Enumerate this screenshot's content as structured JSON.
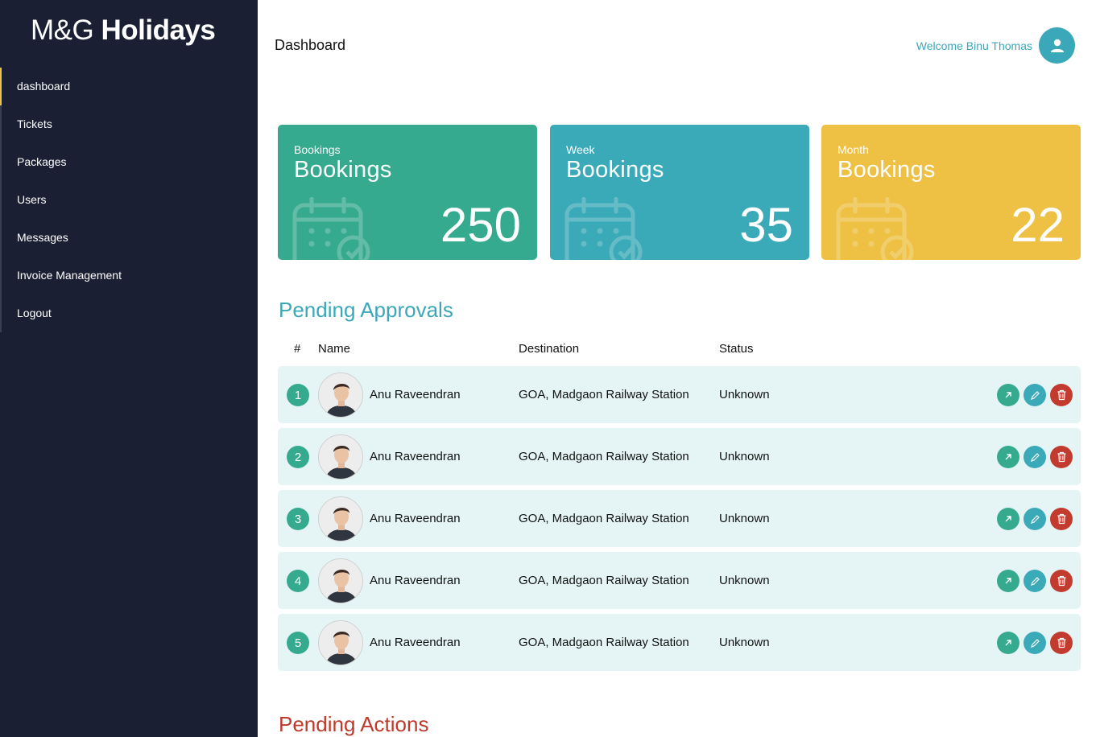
{
  "brand": {
    "light": "M&G",
    "bold": "Holidays"
  },
  "sidebar": {
    "items": [
      {
        "label": "dashboard",
        "active": true
      },
      {
        "label": "Tickets"
      },
      {
        "label": "Packages"
      },
      {
        "label": "Users"
      },
      {
        "label": "Messages"
      },
      {
        "label": "Invoice Management"
      },
      {
        "label": "Logout"
      }
    ]
  },
  "header": {
    "title": "Dashboard",
    "welcome": "Welcome Binu Thomas",
    "avatar_icon": "user-icon"
  },
  "stats": [
    {
      "small": "Bookings",
      "big": "Bookings",
      "value": "250",
      "color": "#36aa8e",
      "icon": "calendar-check-icon"
    },
    {
      "small": "Week",
      "big": "Bookings",
      "value": "35",
      "color": "#3aa9b8",
      "icon": "calendar-check-icon"
    },
    {
      "small": "Month",
      "big": "Bookings",
      "value": "22",
      "color": "#eec043",
      "icon": "calendar-check-icon"
    }
  ],
  "approvals": {
    "title": "Pending Approvals",
    "columns": [
      "#",
      "Name",
      "Destination",
      "Status"
    ],
    "rows": [
      {
        "num": "1",
        "name": "Anu Raveendran",
        "destination": "GOA, Madgaon Railway Station",
        "status": "Unknown"
      },
      {
        "num": "2",
        "name": "Anu Raveendran",
        "destination": "GOA, Madgaon Railway Station",
        "status": "Unknown"
      },
      {
        "num": "3",
        "name": "Anu Raveendran",
        "destination": "GOA, Madgaon Railway Station",
        "status": "Unknown"
      },
      {
        "num": "4",
        "name": "Anu Raveendran",
        "destination": "GOA, Madgaon Railway Station",
        "status": "Unknown"
      },
      {
        "num": "5",
        "name": "Anu Raveendran",
        "destination": "GOA, Madgaon Railway Station",
        "status": "Unknown"
      }
    ],
    "actions": [
      "open-icon",
      "edit-icon",
      "trash-icon"
    ],
    "colors": {
      "open": "#36aa8e",
      "edit": "#3aa9b8",
      "delete": "#c33a2e"
    }
  },
  "actions_section": {
    "title": "Pending Actions"
  }
}
